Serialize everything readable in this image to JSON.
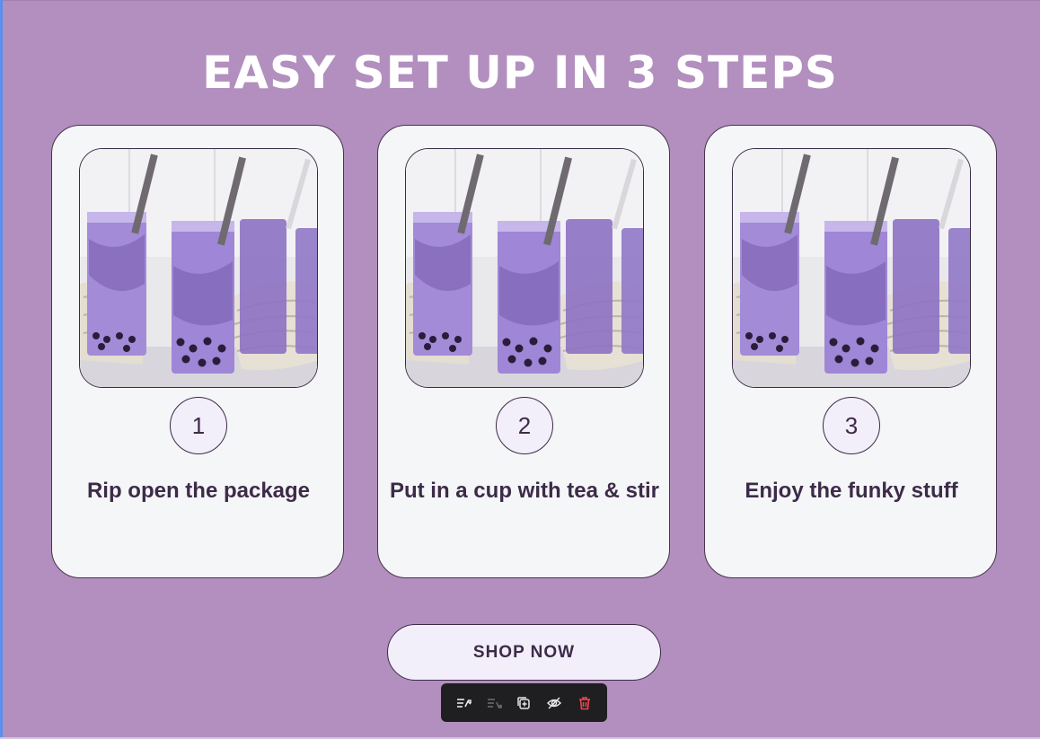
{
  "section": {
    "title": "EASY SET UP IN 3 STEPS"
  },
  "steps": [
    {
      "number": "1",
      "text": "Rip open the package",
      "image_icon": "bubble-tea-photo"
    },
    {
      "number": "2",
      "text": "Put in a cup with tea & stir",
      "image_icon": "bubble-tea-photo"
    },
    {
      "number": "3",
      "text": "Enjoy the funky stuff",
      "image_icon": "bubble-tea-photo"
    }
  ],
  "cta": {
    "label": "SHOP NOW"
  },
  "editor_toolbar": {
    "items": [
      "move-up-icon",
      "move-down-icon",
      "duplicate-icon",
      "hide-icon",
      "delete-icon"
    ]
  },
  "colors": {
    "background": "#b28fbe",
    "card": "#f5f6f7",
    "text_dark": "#3d2b49",
    "delete": "#e5484d"
  }
}
